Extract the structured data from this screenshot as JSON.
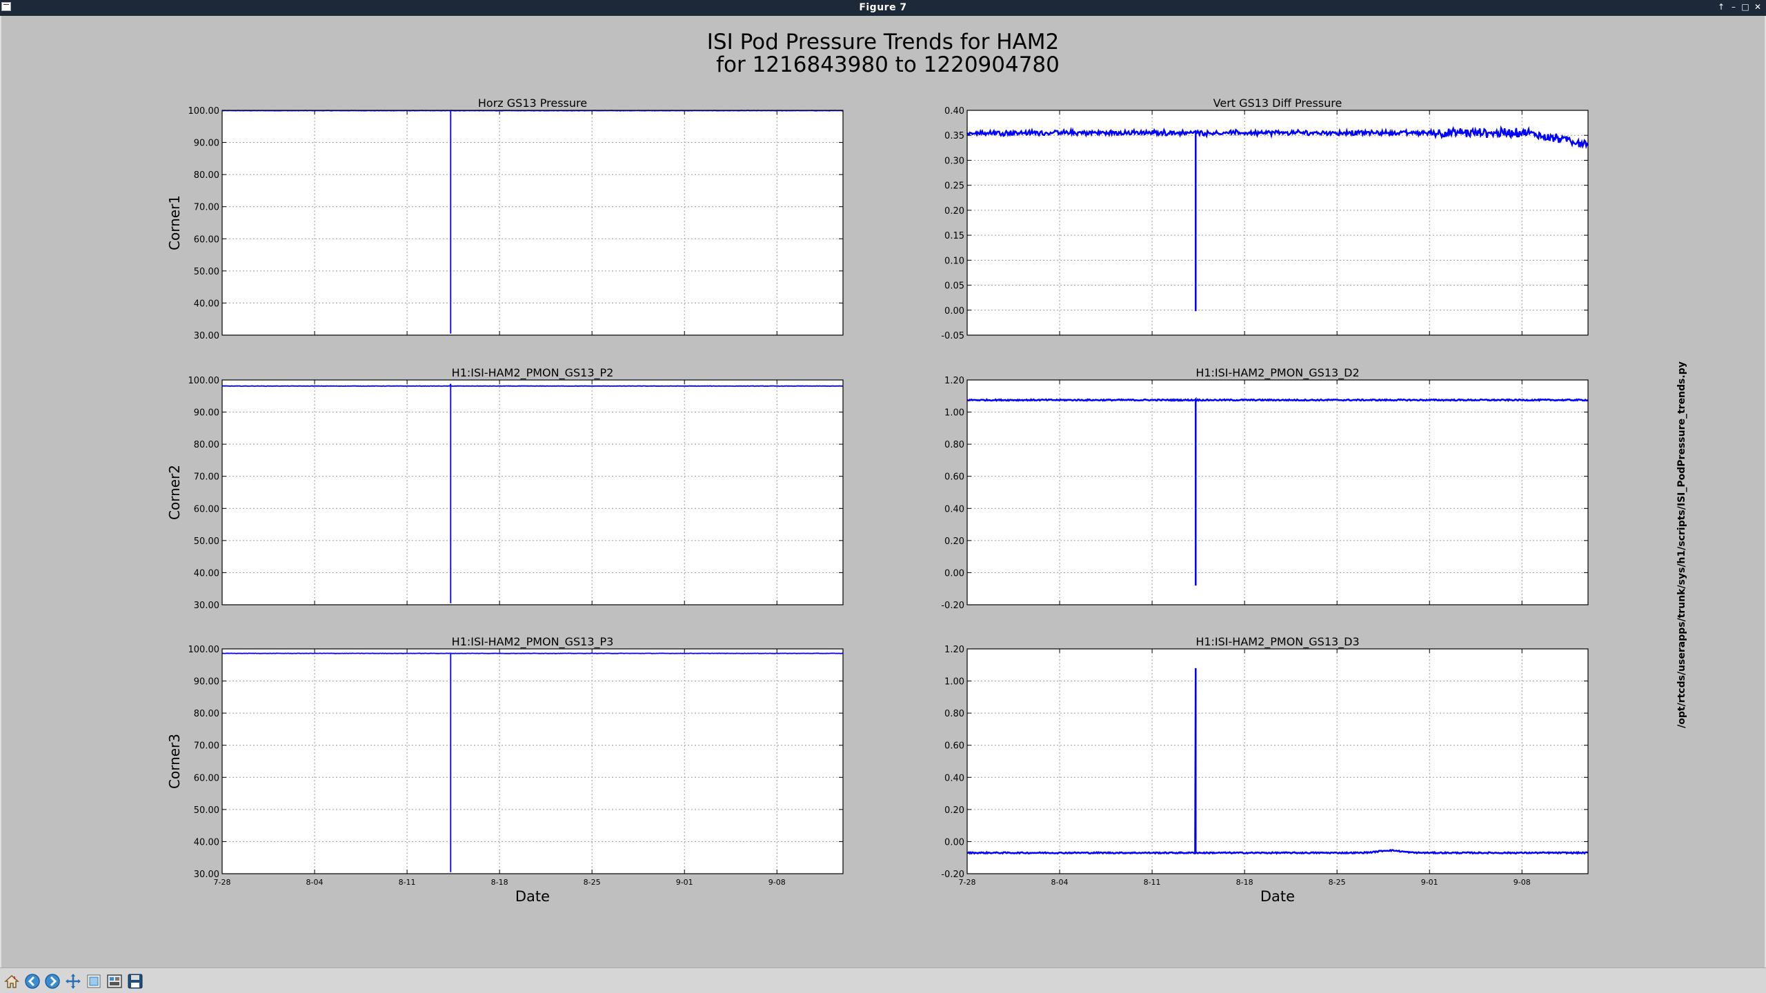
{
  "window": {
    "title": "Figure 7"
  },
  "figure": {
    "suptitle_line1": "ISI Pod Pressure Trends for HAM2",
    "suptitle_line2": "for 1216843980 to 1220904780",
    "side_text": "/opt/rtcds/userapps/trunk/sys/h1/scripts/ISI_PodPressure_trends.py",
    "line_color": "#0000ff",
    "x_ticks": [
      "7-28",
      "8-04",
      "8-11",
      "8-18",
      "8-25",
      "9-01",
      "9-08"
    ],
    "xlabel": "Date"
  },
  "toolbar": {
    "buttons": [
      "home-icon",
      "back-icon",
      "forward-icon",
      "pan-icon",
      "zoom-icon",
      "subplots-icon",
      "save-icon"
    ]
  },
  "chart_data": [
    {
      "type": "line",
      "title": "Horz GS13 Pressure",
      "ylabel": "Corner1",
      "xlabel": "",
      "ylim": [
        30,
        100
      ],
      "yticks": [
        "30.00",
        "40.00",
        "50.00",
        "60.00",
        "70.00",
        "80.00",
        "90.00",
        "100.00"
      ],
      "x_date_range": [
        "7-28",
        "9-13"
      ],
      "spike_date": "8-14",
      "series": [
        {
          "baseline": 99.9,
          "noise": 0.05,
          "spike_min": 30.5,
          "spike_max": 99.9
        }
      ]
    },
    {
      "type": "line",
      "title": "Vert GS13 Diff Pressure",
      "ylabel": "",
      "xlabel": "",
      "ylim": [
        -0.05,
        0.4
      ],
      "yticks": [
        "-0.05",
        "0.00",
        "0.05",
        "0.10",
        "0.15",
        "0.20",
        "0.25",
        "0.30",
        "0.35",
        "0.40"
      ],
      "x_date_range": [
        "7-28",
        "9-13"
      ],
      "spike_date": "8-14",
      "series": [
        {
          "baseline": 0.355,
          "noise": 0.003,
          "spike_min": -0.002,
          "spike_max": 0.36,
          "end_trend": -0.022
        }
      ]
    },
    {
      "type": "line",
      "title": "H1:ISI-HAM2_PMON_GS13_P2",
      "ylabel": "Corner2",
      "xlabel": "",
      "ylim": [
        30,
        100
      ],
      "yticks": [
        "30.00",
        "40.00",
        "50.00",
        "60.00",
        "70.00",
        "80.00",
        "90.00",
        "100.00"
      ],
      "x_date_range": [
        "7-28",
        "9-13"
      ],
      "spike_date": "8-14",
      "series": [
        {
          "baseline": 98.1,
          "noise": 0.05,
          "spike_min": 30.5,
          "spike_max": 98.8
        }
      ]
    },
    {
      "type": "line",
      "title": "H1:ISI-HAM2_PMON_GS13_D2",
      "ylabel": "",
      "xlabel": "",
      "ylim": [
        -0.2,
        1.2
      ],
      "yticks": [
        "-0.20",
        "0.00",
        "0.20",
        "0.40",
        "0.60",
        "0.80",
        "1.00",
        "1.20"
      ],
      "x_date_range": [
        "7-28",
        "9-13"
      ],
      "spike_date": "8-14",
      "series": [
        {
          "baseline": 1.075,
          "noise": 0.004,
          "spike_min": -0.08,
          "spike_max": 1.08
        }
      ]
    },
    {
      "type": "line",
      "title": "H1:ISI-HAM2_PMON_GS13_P3",
      "ylabel": "Corner3",
      "xlabel": "Date",
      "ylim": [
        30,
        100
      ],
      "yticks": [
        "30.00",
        "40.00",
        "50.00",
        "60.00",
        "70.00",
        "80.00",
        "90.00",
        "100.00"
      ],
      "x_date_range": [
        "7-28",
        "9-13"
      ],
      "spike_date": "8-14",
      "series": [
        {
          "baseline": 98.6,
          "noise": 0.05,
          "spike_min": 30.5,
          "spike_max": 98.6
        }
      ]
    },
    {
      "type": "line",
      "title": "H1:ISI-HAM2_PMON_GS13_D3",
      "ylabel": "",
      "xlabel": "Date",
      "ylim": [
        -0.2,
        1.2
      ],
      "yticks": [
        "-0.20",
        "0.00",
        "0.20",
        "0.40",
        "0.60",
        "0.80",
        "1.00",
        "1.20"
      ],
      "x_date_range": [
        "7-28",
        "9-13"
      ],
      "spike_date": "8-14",
      "series": [
        {
          "baseline": -0.07,
          "noise": 0.004,
          "spike_min": -0.07,
          "spike_max": 1.08,
          "bump_date": "8-29",
          "bump_height": 0.015
        }
      ]
    }
  ]
}
